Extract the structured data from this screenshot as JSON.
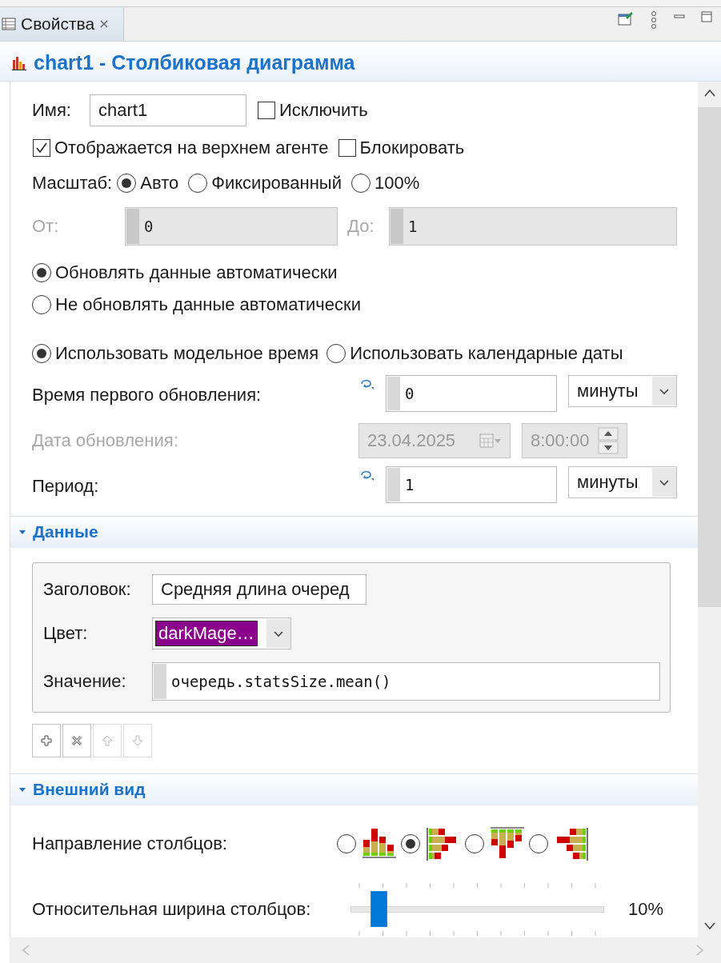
{
  "view_tab": {
    "label": "Свойства",
    "selected": true
  },
  "header": {
    "title": "chart1 - Столбиковая диаграмма"
  },
  "name_row": {
    "label": "Имя:",
    "value": "chart1"
  },
  "checks": [
    {
      "label": "Исключить",
      "checked": false
    },
    {
      "label": "Отображается на верхнем агенте",
      "checked": true
    },
    {
      "label": "Блокировать",
      "checked": false
    }
  ],
  "scale": {
    "label": "Масштаб:",
    "options": [
      {
        "label": "Авто",
        "selected": true
      },
      {
        "label": "Фиксированный",
        "selected": false
      },
      {
        "label": "100%",
        "selected": false
      }
    ]
  },
  "range": {
    "disabled": true,
    "from_label": "От:",
    "from_value": "0",
    "to_label": "До:",
    "to_value": "1"
  },
  "update_mode": [
    {
      "label": "Обновлять данные автоматически",
      "selected": true
    },
    {
      "label": "Не обновлять данные автоматически",
      "selected": false
    }
  ],
  "time_mode": [
    {
      "label": "Использовать модельное время",
      "selected": true
    },
    {
      "label": "Использовать календарные даты",
      "selected": false
    }
  ],
  "first_update": {
    "label": "Время первого обновления:",
    "value": "0",
    "unit": "минуты"
  },
  "update_date": {
    "label": "Дата обновления:",
    "disabled": true,
    "date": "23.04.2025",
    "time": "8:00:00"
  },
  "period": {
    "label": "Период:",
    "value": "1",
    "unit": "минуты"
  },
  "data_section": {
    "title": "Данные",
    "expanded": true,
    "item": {
      "title_label": "Заголовок:",
      "title_value": "Средняя длина очеред",
      "color_label": "Цвет:",
      "color_name": "darkMage…",
      "color": "#8b008b",
      "value_label": "Значение:",
      "value": "очередь.statsSize.mean()"
    },
    "buttons": [
      {
        "kind": "add",
        "disabled": false
      },
      {
        "kind": "remove",
        "disabled": false
      },
      {
        "kind": "up",
        "disabled": true
      },
      {
        "kind": "down",
        "disabled": true
      }
    ]
  },
  "appearance": {
    "title": "Внешний вид",
    "expanded": true,
    "direction": {
      "label": "Направление столбцов:",
      "options": [
        {
          "kind": "up",
          "selected": false
        },
        {
          "kind": "right",
          "selected": true
        },
        {
          "kind": "down",
          "selected": false
        },
        {
          "kind": "left",
          "selected": false
        }
      ]
    },
    "bar_width": {
      "label": "Относительная ширина столбцов:",
      "level": 0.1,
      "reading": "10%"
    }
  }
}
